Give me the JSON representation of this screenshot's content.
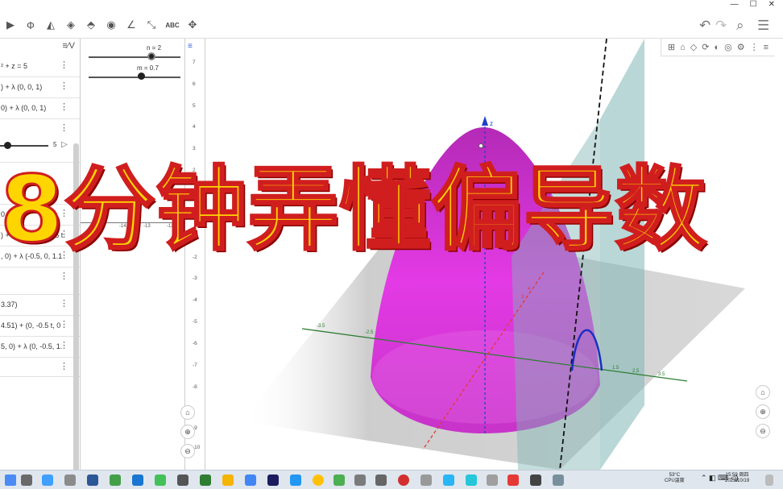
{
  "overlay_title": "8分钟弄懂偏导数",
  "window_controls": [
    "—",
    "☐",
    "✕"
  ],
  "toolbar": {
    "tools": [
      {
        "icon": "point-icon",
        "glyph": "▶"
      },
      {
        "icon": "circle-icon",
        "glyph": "Ф"
      },
      {
        "icon": "pyramid-icon",
        "glyph": "◭"
      },
      {
        "icon": "net-icon",
        "glyph": "◈"
      },
      {
        "icon": "prism-icon",
        "glyph": "⬘"
      },
      {
        "icon": "sphere-icon",
        "glyph": "◉"
      },
      {
        "icon": "angle-icon",
        "glyph": "∠"
      },
      {
        "icon": "reflect-icon",
        "glyph": "⤡"
      },
      {
        "icon": "text-icon",
        "glyph": "ABC"
      },
      {
        "icon": "move-view-icon",
        "glyph": "✥"
      }
    ],
    "undo": "↶",
    "redo": "↷",
    "search": "⌕",
    "menu": "☰"
  },
  "algebra": {
    "sort_label": "≡⁄V",
    "rows": [
      "² + z = 5",
      ") + λ (0, 0, 1)",
      "0) + λ (0, 0, 1)",
      "",
      "0.34)",
      ") + (-0.5 t, 0, -0.25 t",
      ", 0) + λ (-0.5, 0, 1.1",
      "",
      " 3.37)",
      "4.51) + (0, -0.5 t, 0",
      "5, 0) + λ (0, -0.5, 1.",
      ""
    ],
    "slider_row_value": "5"
  },
  "sliders": {
    "n_label": "n = 2",
    "n_value": 2,
    "m_label": "m = 0.7",
    "m_value": 0.7
  },
  "axis_ticks": [
    "7",
    "6",
    "5",
    "4",
    "3",
    "2",
    "1",
    "0",
    "-1",
    "-2",
    "-3",
    "-4",
    "-5",
    "-6",
    "-7",
    "-8",
    "-9",
    "-10"
  ],
  "left_x_ticks": [
    "-14",
    "-13",
    "-12"
  ],
  "view3d": {
    "z_label": "z",
    "x_ticks": [
      "-3.5",
      "-3",
      "-2.5",
      "-2",
      "-1.5",
      "1.5",
      "2",
      "2.5",
      "3",
      "3.5"
    ],
    "y_ticks": [
      "4",
      "3",
      "2",
      "1"
    ]
  },
  "nav_buttons": {
    "home": "⌂",
    "zoom_in": "⊕",
    "zoom_out": "⊖"
  },
  "taskbar": {
    "temp": "53°C",
    "cpu": "CPU温度",
    "time": "15:59 周四",
    "date": "2023/10/19"
  },
  "colors": {
    "paraboloid": "#e33ae5",
    "plane": "#7fb6b4",
    "curve": "#1a2fc4",
    "title_fill": "#ffd500",
    "title_stroke": "#d01e1e"
  }
}
